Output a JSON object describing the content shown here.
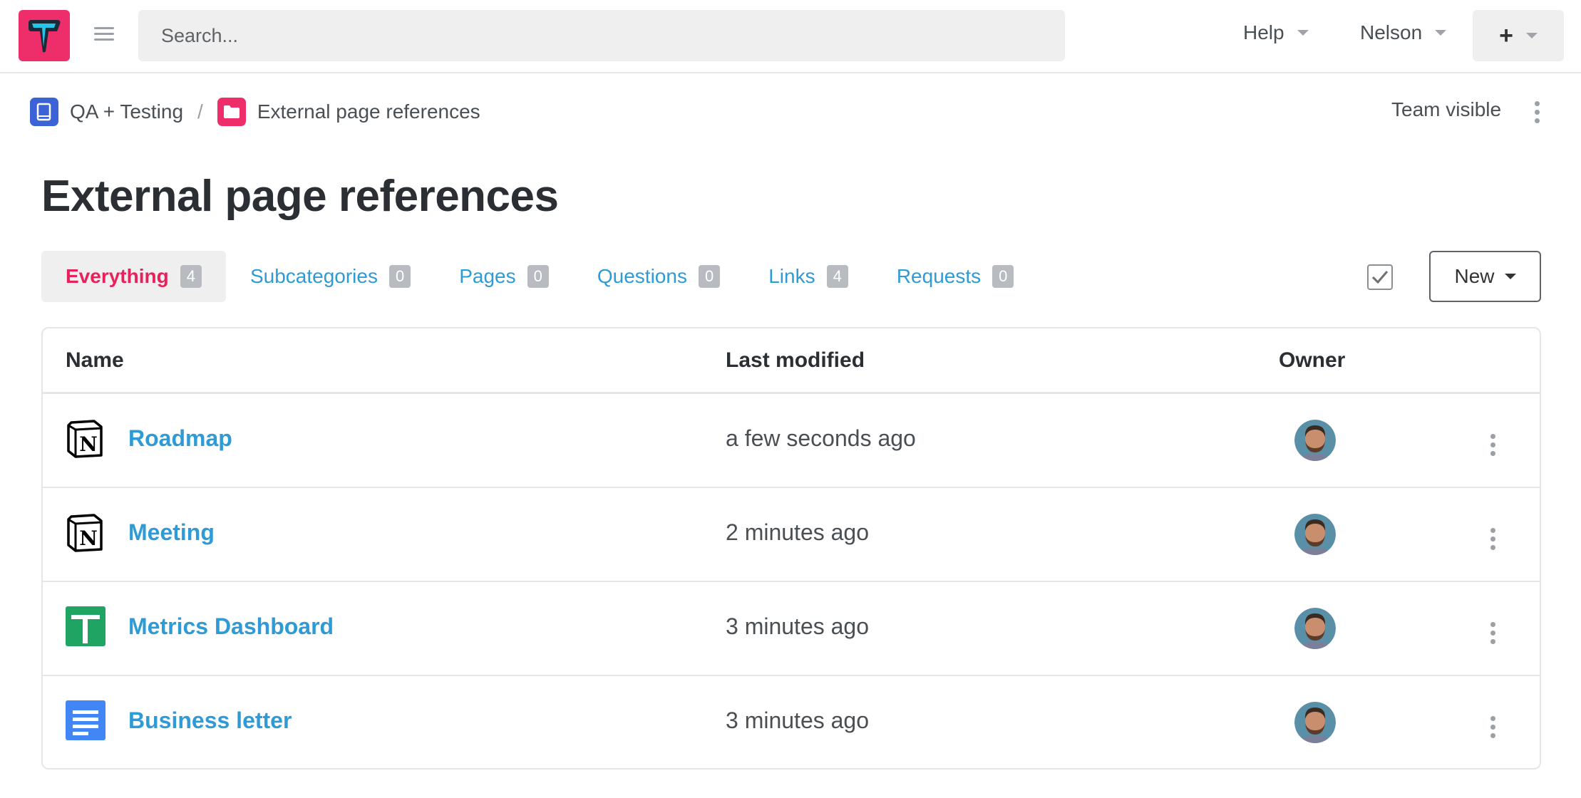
{
  "header": {
    "search_placeholder": "Search...",
    "help_label": "Help",
    "user_label": "Nelson",
    "plus_label": "+"
  },
  "breadcrumb": {
    "parent": "QA + Testing",
    "separator": "/",
    "current": "External page references",
    "visibility": "Team visible"
  },
  "page": {
    "title": "External page references"
  },
  "tabs": [
    {
      "label": "Everything",
      "count": "4"
    },
    {
      "label": "Subcategories",
      "count": "0"
    },
    {
      "label": "Pages",
      "count": "0"
    },
    {
      "label": "Questions",
      "count": "0"
    },
    {
      "label": "Links",
      "count": "4"
    },
    {
      "label": "Requests",
      "count": "0"
    }
  ],
  "new_button_label": "New",
  "table": {
    "columns": {
      "name": "Name",
      "modified": "Last modified",
      "owner": "Owner"
    },
    "rows": [
      {
        "icon": "notion-icon",
        "name": "Roadmap",
        "modified": "a few seconds ago"
      },
      {
        "icon": "notion-icon",
        "name": "Meeting",
        "modified": "2 minutes ago"
      },
      {
        "icon": "google-sheets-icon",
        "name": "Metrics Dashboard",
        "modified": "3 minutes ago"
      },
      {
        "icon": "google-docs-icon",
        "name": "Business letter",
        "modified": "3 minutes ago"
      }
    ]
  },
  "colors": {
    "brand": "#ee2e6b",
    "link": "#2e9bd6",
    "active_tab": "#e8215c"
  }
}
